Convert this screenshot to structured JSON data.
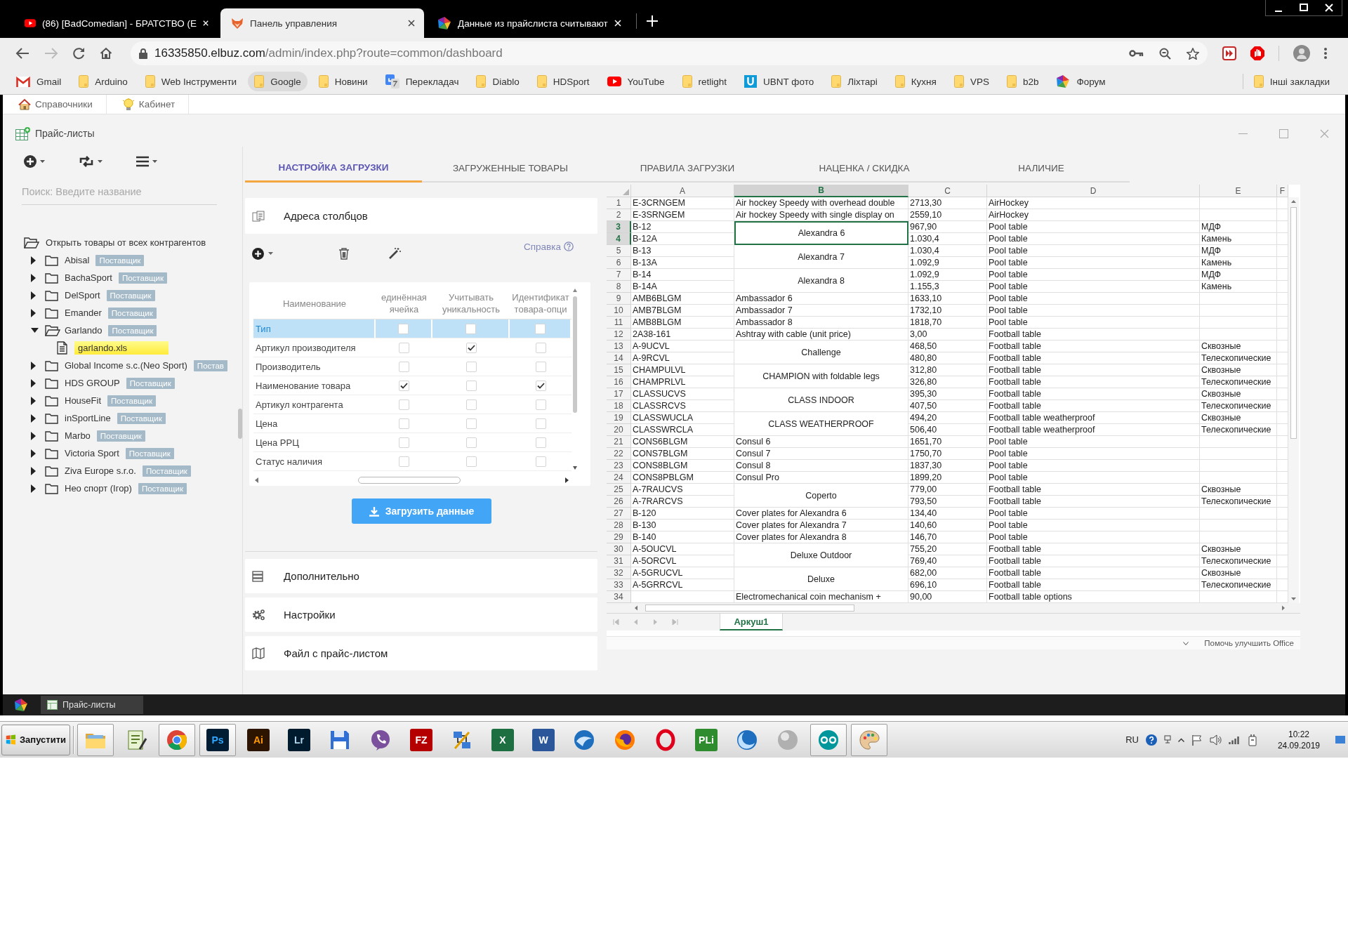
{
  "browser": {
    "tabs": [
      {
        "title": "(86) [BadComedian] - БРАТСТВО (Е",
        "kind": "video",
        "selected": false
      },
      {
        "title": "Панель управления",
        "kind": "fox",
        "selected": true
      },
      {
        "title": "Данные из прайслиста считывают",
        "kind": "pinwheel",
        "selected": false
      }
    ],
    "address": {
      "host": "16335850.elbuz.com",
      "path": "/admin/index.php?route=common/dashboard"
    },
    "bookmarks": [
      {
        "label": "Gmail",
        "kind": "mail",
        "hovered": false
      },
      {
        "label": "Arduino",
        "kind": "folder",
        "hovered": false
      },
      {
        "label": "Web Інструменти",
        "kind": "folder",
        "hovered": false
      },
      {
        "label": "Google",
        "kind": "folder",
        "hovered": true
      },
      {
        "label": "Новини",
        "kind": "folder",
        "hovered": false
      },
      {
        "label": "Перекладач",
        "kind": "translate",
        "hovered": false
      },
      {
        "label": "Diablo",
        "kind": "folder",
        "hovered": false
      },
      {
        "label": "HDSport",
        "kind": "folder",
        "hovered": false
      },
      {
        "label": "YouTube",
        "kind": "video",
        "hovered": false
      },
      {
        "label": "retlight",
        "kind": "folder",
        "hovered": false
      },
      {
        "label": "UBNT фото",
        "kind": "tile",
        "hovered": false
      },
      {
        "label": "Ліхтарі",
        "kind": "folder",
        "hovered": false
      },
      {
        "label": "Кухня",
        "kind": "folder",
        "hovered": false
      },
      {
        "label": "VPS",
        "kind": "folder",
        "hovered": false
      },
      {
        "label": "b2b",
        "kind": "folder",
        "hovered": false
      },
      {
        "label": "Форум",
        "kind": "pinwheel",
        "hovered": false
      }
    ],
    "other_bookmarks": "Інші закладки"
  },
  "page_links": [
    {
      "label": "Справочники"
    },
    {
      "label": "Кабинет"
    }
  ],
  "app": {
    "title": "Прайс-листы",
    "sidebar": {
      "search": {
        "placeholder": "Поиск: Введите название"
      },
      "tree": {
        "label": "Открыть товары от всех контрагентов",
        "children": [
          {
            "label": "Abisal",
            "badge": "Поставщик",
            "expanded": false,
            "selected": false
          },
          {
            "label": "BachaSport",
            "badge": "Поставщик",
            "expanded": false,
            "selected": false
          },
          {
            "label": "DelSport",
            "badge": "Поставщик",
            "expanded": false,
            "selected": false
          },
          {
            "label": "Emander",
            "badge": "Поставщик",
            "expanded": false,
            "selected": false
          },
          {
            "label": "Garlando",
            "badge": "Поставщик",
            "expanded": true,
            "selected": false,
            "children": [
              {
                "label": "garlando.xls",
                "selected": true
              }
            ]
          },
          {
            "label": "Global Income s.c.(Neo Sport)",
            "badge": "Постав",
            "expanded": false,
            "selected": false
          },
          {
            "label": "HDS GROUP",
            "badge": "Поставщик",
            "expanded": false,
            "selected": false
          },
          {
            "label": "HouseFit",
            "badge": "Поставщик",
            "expanded": false,
            "selected": false
          },
          {
            "label": "inSportLine",
            "badge": "Поставщик",
            "expanded": false,
            "selected": false
          },
          {
            "label": "Marbo",
            "badge": "Поставщик",
            "expanded": false,
            "selected": false
          },
          {
            "label": "Victoria Sport",
            "badge": "Поставщик",
            "expanded": false,
            "selected": false
          },
          {
            "label": "Ziva Europe s.r.o.",
            "badge": "Поставщик",
            "expanded": false,
            "selected": false
          },
          {
            "label": "Нео спорт (Ігор)",
            "badge": "Поставщик",
            "expanded": false,
            "selected": false
          }
        ]
      }
    },
    "tabs": [
      {
        "label": "НАСТРОЙКА ЗАГРУЗКИ",
        "selected": true
      },
      {
        "label": "ЗАГРУЖЕННЫЕ ТОВАРЫ",
        "selected": false
      },
      {
        "label": "ПРАВИЛА ЗАГРУЗКИ",
        "selected": false
      },
      {
        "label": "НАЦЕНКА / СКИДКА",
        "selected": false
      },
      {
        "label": "НАЛИЧИЕ",
        "selected": false
      }
    ],
    "mapping": {
      "title": "Адреса столбцов",
      "help": "Справка",
      "columns": [
        "Наименование",
        "единённая\nячейка",
        "Учитывать\nуникальность",
        "Идентификат\nтовара-опци"
      ],
      "rows": [
        {
          "name": "Тип",
          "selected": true,
          "cells": [
            {
              "checked": false
            },
            {
              "checked": false
            },
            {
              "checked": false
            }
          ]
        },
        {
          "name": "Артикул производителя",
          "selected": false,
          "cells": [
            {
              "checked": false
            },
            {
              "checked": true
            },
            {
              "checked": false
            }
          ]
        },
        {
          "name": "Производитель",
          "selected": false,
          "cells": [
            {
              "checked": false
            },
            {
              "checked": false
            },
            {
              "checked": false
            }
          ]
        },
        {
          "name": "Наименование товара",
          "selected": false,
          "cells": [
            {
              "checked": true
            },
            {
              "checked": false
            },
            {
              "checked": true
            }
          ]
        },
        {
          "name": "Артикул контрагента",
          "selected": false,
          "cells": [
            {
              "checked": false
            },
            {
              "checked": false
            },
            {
              "checked": false
            }
          ]
        },
        {
          "name": "Цена",
          "selected": false,
          "cells": [
            {
              "checked": false
            },
            {
              "checked": false
            },
            {
              "checked": false
            }
          ]
        },
        {
          "name": "Цена РРЦ",
          "selected": false,
          "cells": [
            {
              "checked": false
            },
            {
              "checked": false
            },
            {
              "checked": false
            }
          ]
        },
        {
          "name": "Статус наличия",
          "selected": false,
          "cells": [
            {
              "checked": false
            },
            {
              "checked": false
            },
            {
              "checked": false
            }
          ]
        }
      ]
    },
    "load_button": "Загрузить данные",
    "sections": [
      {
        "title": "Дополнительно"
      },
      {
        "title": "Настройки"
      },
      {
        "title": "Файл с прайс-листом"
      }
    ],
    "sheet": {
      "columns": [
        {
          "label": "A",
          "selected": false
        },
        {
          "label": "B",
          "selected": true
        },
        {
          "label": "C",
          "selected": false
        },
        {
          "label": "D",
          "selected": false
        },
        {
          "label": "E",
          "selected": false
        },
        {
          "label": "F",
          "selected": false
        }
      ],
      "groups": [
        {
          "b": "Air hockey Speedy with overhead double",
          "selected": false,
          "rows": [
            {
              "number": "1",
              "a": "E-3CRNGEM",
              "c": "2713,30",
              "d": "AirHockey"
            }
          ]
        },
        {
          "b": "Air hockey Speedy with single display on",
          "selected": false,
          "rows": [
            {
              "number": "2",
              "a": "E-3SRNGEM",
              "c": "2559,10",
              "d": "AirHockey"
            }
          ]
        },
        {
          "b": "Alexandra 6",
          "selected": true,
          "rows": [
            {
              "number": "3",
              "a": "B-12",
              "c": "967,90",
              "d": "Pool table",
              "e": "МДФ"
            },
            {
              "number": "4",
              "a": "B-12A",
              "c": "1.030,4",
              "d": "Pool table",
              "e": "Камень"
            }
          ]
        },
        {
          "b": "Alexandra 7",
          "selected": false,
          "rows": [
            {
              "number": "5",
              "a": "B-13",
              "c": "1.030,4",
              "d": "Pool table",
              "e": "МДФ"
            },
            {
              "number": "6",
              "a": "B-13A",
              "c": "1.092,9",
              "d": "Pool table",
              "e": "Камень"
            }
          ]
        },
        {
          "b": "Alexandra 8",
          "selected": false,
          "rows": [
            {
              "number": "7",
              "a": "B-14",
              "c": "1.092,9",
              "d": "Pool table",
              "e": "МДФ"
            },
            {
              "number": "8",
              "a": "B-14A",
              "c": "1.155,3",
              "d": "Pool table",
              "e": "Камень"
            }
          ]
        },
        {
          "b": "Ambassador 6",
          "selected": false,
          "rows": [
            {
              "number": "9",
              "a": "AMB6BLGM",
              "c": "1633,10",
              "d": "Pool table"
            }
          ]
        },
        {
          "b": "Ambassador 7",
          "selected": false,
          "rows": [
            {
              "number": "10",
              "a": "AMB7BLGM",
              "c": "1732,10",
              "d": "Pool table"
            }
          ]
        },
        {
          "b": "Ambassador 8",
          "selected": false,
          "rows": [
            {
              "number": "11",
              "a": "AMB8BLGM",
              "c": "1818,70",
              "d": "Pool table"
            }
          ]
        },
        {
          "b": "Ashtray with cable (unit price)",
          "selected": false,
          "rows": [
            {
              "number": "12",
              "a": "2A38-161",
              "c": "3,00",
              "d": "Football table"
            }
          ]
        },
        {
          "b": "Challenge",
          "selected": false,
          "rows": [
            {
              "number": "13",
              "a": "A-9UCVL",
              "c": "468,50",
              "d": "Football table",
              "e": "Сквозные"
            },
            {
              "number": "14",
              "a": "A-9RCVL",
              "c": "480,80",
              "d": "Football table",
              "e": "Телескопические"
            }
          ]
        },
        {
          "b": "CHAMPION with foldable legs",
          "selected": false,
          "rows": [
            {
              "number": "15",
              "a": "CHAMPULVL",
              "c": "312,80",
              "d": "Football table",
              "e": "Сквозные"
            },
            {
              "number": "16",
              "a": "CHAMPRLVL",
              "c": "326,80",
              "d": "Football table",
              "e": "Телескопические"
            }
          ]
        },
        {
          "b": "CLASS INDOOR",
          "selected": false,
          "rows": [
            {
              "number": "17",
              "a": "CLASSUCVS",
              "c": "395,30",
              "d": "Football table",
              "e": "Сквозные"
            },
            {
              "number": "18",
              "a": "CLASSRCVS",
              "c": "407,50",
              "d": "Football table",
              "e": "Телескопические"
            }
          ]
        },
        {
          "b": "CLASS WEATHERPROOF",
          "selected": false,
          "rows": [
            {
              "number": "19",
              "a": "CLASSWUCLA",
              "c": "494,20",
              "d": "Football table weatherproof",
              "e": "Сквозные"
            },
            {
              "number": "20",
              "a": "CLASSWRCLA",
              "c": "506,40",
              "d": "Football table weatherproof",
              "e": "Телескопические"
            }
          ]
        },
        {
          "b": "Consul 6",
          "selected": false,
          "rows": [
            {
              "number": "21",
              "a": "CONS6BLGM",
              "c": "1651,70",
              "d": "Pool table"
            }
          ]
        },
        {
          "b": "Consul 7",
          "selected": false,
          "rows": [
            {
              "number": "22",
              "a": "CONS7BLGM",
              "c": "1750,70",
              "d": "Pool table"
            }
          ]
        },
        {
          "b": "Consul 8",
          "selected": false,
          "rows": [
            {
              "number": "23",
              "a": "CONS8BLGM",
              "c": "1837,30",
              "d": "Pool table"
            }
          ]
        },
        {
          "b": "Consul Pro",
          "selected": false,
          "rows": [
            {
              "number": "24",
              "a": "CONS8PBLGM",
              "c": "1899,20",
              "d": "Pool table"
            }
          ]
        },
        {
          "b": "Coperto",
          "selected": false,
          "rows": [
            {
              "number": "25",
              "a": "A-7RAUCVS",
              "c": "779,00",
              "d": "Football table",
              "e": "Сквозные"
            },
            {
              "number": "26",
              "a": "A-7RARCVS",
              "c": "793,50",
              "d": "Football table",
              "e": "Телескопические"
            }
          ]
        },
        {
          "b": "Cover plates for Alexandra 6",
          "selected": false,
          "rows": [
            {
              "number": "27",
              "a": "B-120",
              "c": "134,40",
              "d": "Pool table"
            }
          ]
        },
        {
          "b": "Cover plates for Alexandra 7",
          "selected": false,
          "rows": [
            {
              "number": "28",
              "a": "B-130",
              "c": "140,60",
              "d": "Pool table"
            }
          ]
        },
        {
          "b": "Cover plates for Alexandra 8",
          "selected": false,
          "rows": [
            {
              "number": "29",
              "a": "B-140",
              "c": "146,70",
              "d": "Pool table"
            }
          ]
        },
        {
          "b": "Deluxe Outdoor",
          "selected": false,
          "rows": [
            {
              "number": "30",
              "a": "A-5OUCVL",
              "c": "755,20",
              "d": "Football table",
              "e": "Сквозные"
            },
            {
              "number": "31",
              "a": "A-5ORCVL",
              "c": "769,40",
              "d": "Football table",
              "e": "Телескопические"
            }
          ]
        },
        {
          "b": "Deluxe",
          "selected": false,
          "rows": [
            {
              "number": "32",
              "a": "A-5GRUCVL",
              "c": "682,00",
              "d": "Football table",
              "e": "Сквозные"
            },
            {
              "number": "33",
              "a": "A-5GRRCVL",
              "c": "696,10",
              "d": "Football table",
              "e": "Телескопические"
            }
          ]
        },
        {
          "b": "Electromechanical coin mechanism +",
          "selected": false,
          "rows": [
            {
              "number": "34",
              "c": "90,00",
              "d": "Football table options"
            }
          ]
        }
      ],
      "sheet_tabs": [
        {
          "label": "Аркуш1",
          "selected": true
        }
      ],
      "status": "Помочь улучшить Office"
    }
  },
  "app_taskbar": {
    "windows": [
      {
        "label": "Прайс-листы",
        "selected": true
      }
    ]
  },
  "taskbar": {
    "start": "Запустити",
    "launchers": [
      {
        "running": true
      },
      {
        "running": false
      },
      {
        "running": true
      },
      {
        "label": "Ps",
        "running": true
      },
      {
        "label": "Ai",
        "running": false
      },
      {
        "label": "Lr",
        "running": false
      },
      {
        "running": false
      },
      {
        "running": false
      },
      {
        "label": "FZ",
        "running": false
      },
      {
        "running": false
      },
      {
        "label": "X",
        "running": false
      },
      {
        "label": "W",
        "running": false
      },
      {
        "running": false
      },
      {
        "running": false
      },
      {
        "running": false
      },
      {
        "label": "PLi",
        "running": false
      },
      {
        "running": false
      },
      {
        "running": false
      },
      {
        "running": true
      },
      {
        "running": true
      }
    ],
    "tray": {
      "language": "RU",
      "time": "10:22",
      "date": "24.09.2019"
    }
  }
}
